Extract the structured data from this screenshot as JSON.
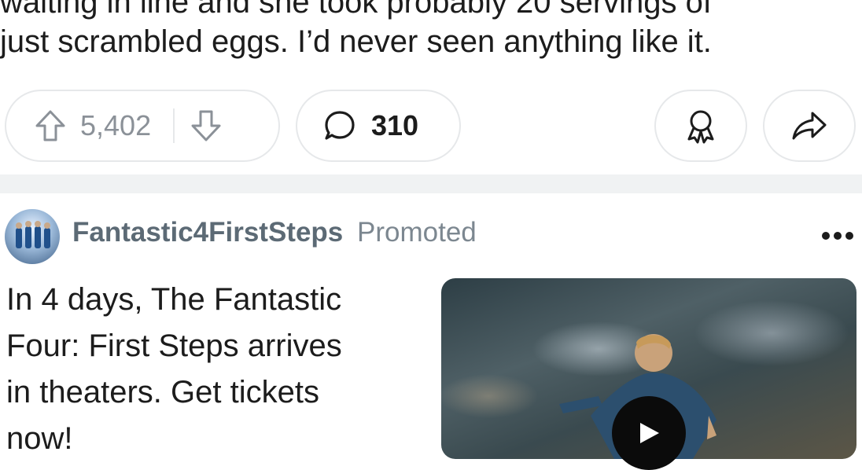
{
  "post": {
    "text_lines": [
      "waiting in line and she took probably 20 servings of",
      "just scrambled eggs. I’d never seen anything like it."
    ]
  },
  "actions": {
    "upvote_count": "5,402",
    "comment_count": "310"
  },
  "promoted": {
    "author": "Fantastic4FirstSteps",
    "tag": "Promoted",
    "body_lines": [
      "In 4 days, The Fantastic",
      "Four: First Steps arrives",
      "in theaters. Get tickets",
      "now!"
    ]
  },
  "icons": {
    "upvote": "arrow-up-icon",
    "downvote": "arrow-down-icon",
    "comment": "speech-bubble-icon",
    "award": "award-ribbon-icon",
    "share": "share-arrow-icon",
    "more": "ellipsis-icon",
    "play": "play-icon"
  },
  "colors": {
    "muted_text": "#8b9198",
    "border": "#e6e8ea",
    "divider": "#f0f2f3",
    "author": "#5c6a75"
  }
}
